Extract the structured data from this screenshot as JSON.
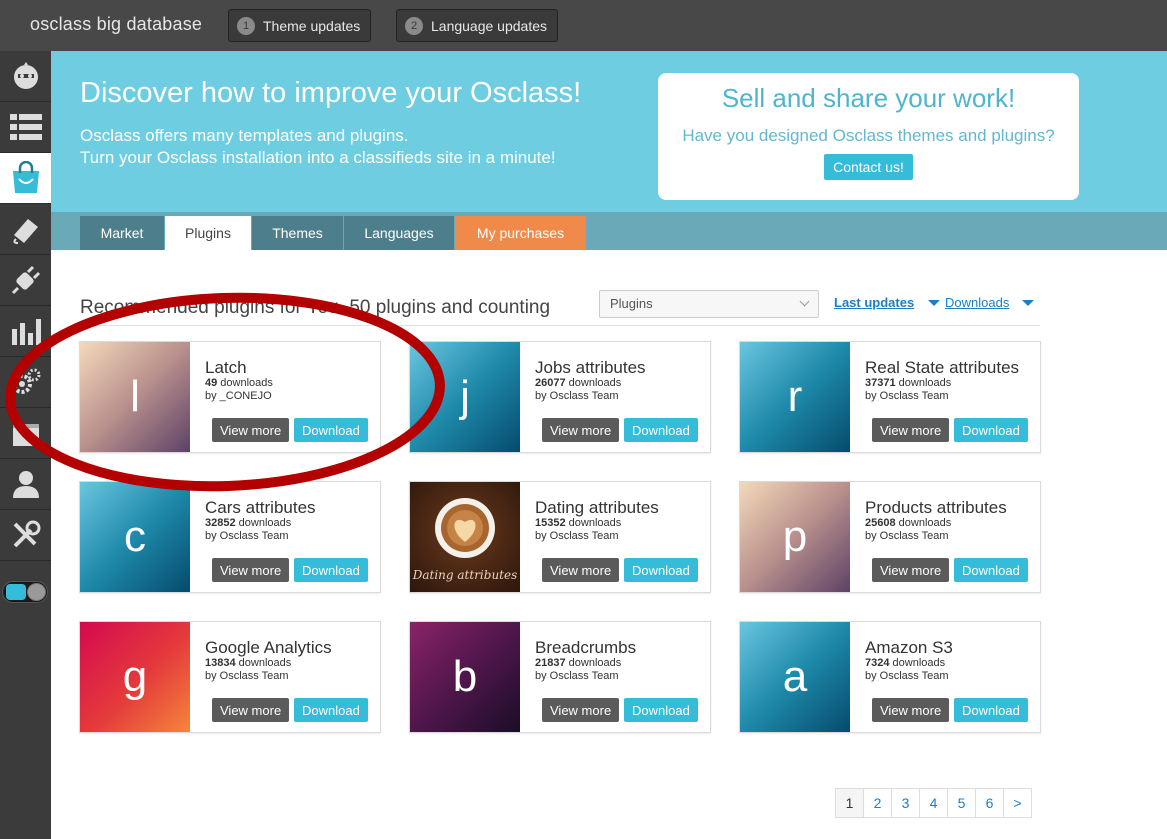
{
  "topbar": {
    "site_title": "osclass big database",
    "updates": [
      {
        "num": "1",
        "label": "Theme updates"
      },
      {
        "num": "2",
        "label": "Language updates"
      }
    ]
  },
  "sidebar": {
    "items": [
      {
        "icon": "dashboard-icon"
      },
      {
        "icon": "listings-icon"
      },
      {
        "icon": "market-bag-icon",
        "active": true
      },
      {
        "icon": "appearance-icon"
      },
      {
        "icon": "plugins-icon"
      },
      {
        "icon": "stats-icon"
      },
      {
        "icon": "settings-gears-icon"
      },
      {
        "icon": "pages-icon"
      },
      {
        "icon": "user-icon"
      },
      {
        "icon": "tools-icon"
      }
    ]
  },
  "banner": {
    "title": "Discover how to improve your Osclass!",
    "line1": "Osclass offers many templates and plugins.",
    "line2": "Turn your Osclass installation into a classifieds site in a minute!",
    "sell_title": "Sell and share your work!",
    "sell_subtitle": "Have you designed Osclass themes and plugins?",
    "contact_label": "Contact us!"
  },
  "tabs": [
    {
      "label": "Market"
    },
    {
      "label": "Plugins",
      "active": true
    },
    {
      "label": "Themes"
    },
    {
      "label": "Languages"
    },
    {
      "label": "My purchases"
    }
  ],
  "content": {
    "section_title": "Recommended plugins for You. 50 plugins and counting",
    "select_value": "Plugins",
    "sort_last_updates": "Last updates",
    "sort_downloads": "Downloads"
  },
  "cards": [
    {
      "letter": "l",
      "name": "Latch",
      "downloads": "49",
      "dl_suffix": " downloads",
      "by": "by _CONEJO",
      "view": "View more",
      "download": "Download"
    },
    {
      "letter": "j",
      "name": "Jobs attributes",
      "downloads": "26077",
      "dl_suffix": " downloads",
      "by": "by Osclass Team",
      "view": "View more",
      "download": "Download"
    },
    {
      "letter": "r",
      "name": "Real State attributes",
      "downloads": "37371",
      "dl_suffix": " downloads",
      "by": "by Osclass Team",
      "view": "View more",
      "download": "Download"
    },
    {
      "letter": "c",
      "name": "Cars attributes",
      "downloads": "32852",
      "dl_suffix": " downloads",
      "by": "by Osclass Team",
      "view": "View more",
      "download": "Download"
    },
    {
      "letter": "",
      "image_text": "Dating attributes",
      "name": "Dating attributes",
      "downloads": "15352",
      "dl_suffix": " downloads",
      "by": "by Osclass Team",
      "view": "View more",
      "download": "Download"
    },
    {
      "letter": "p",
      "name": "Products attributes",
      "downloads": "25608",
      "dl_suffix": " downloads",
      "by": "by Osclass Team",
      "view": "View more",
      "download": "Download"
    },
    {
      "letter": "g",
      "name": "Google Analytics",
      "downloads": "13834",
      "dl_suffix": " downloads",
      "by": "by Osclass Team",
      "view": "View more",
      "download": "Download"
    },
    {
      "letter": "b",
      "name": "Breadcrumbs",
      "downloads": "21837",
      "dl_suffix": " downloads",
      "by": "by Osclass Team",
      "view": "View more",
      "download": "Download"
    },
    {
      "letter": "a",
      "name": "Amazon S3",
      "downloads": "7324",
      "dl_suffix": " downloads",
      "by": "by Osclass Team",
      "view": "View more",
      "download": "Download"
    }
  ],
  "pagination": [
    "1",
    "2",
    "3",
    "4",
    "5",
    "6",
    ">"
  ],
  "colors": {
    "accent": "#35bcd9",
    "banner": "#6fcde2",
    "orange_tab": "#f08a4b",
    "annotation_red": "#b30000"
  }
}
